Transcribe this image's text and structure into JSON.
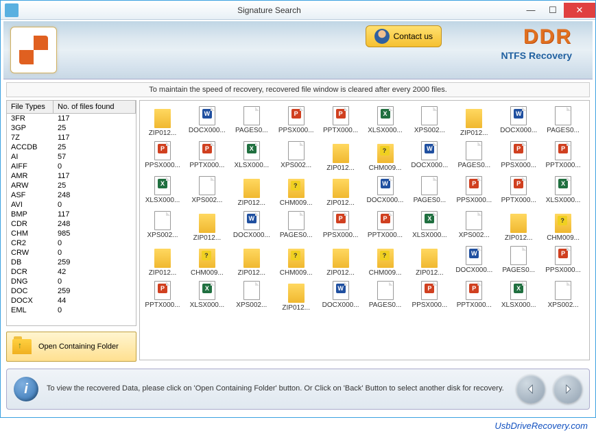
{
  "window": {
    "title": "Signature Search"
  },
  "banner": {
    "contact_label": "Contact us",
    "brand": "DDR",
    "brand_sub": "NTFS Recovery"
  },
  "status_message": "To maintain the speed of recovery, recovered file window is cleared after every 2000 files.",
  "table": {
    "col1": "File Types",
    "col2": "No. of files found",
    "rows": [
      {
        "type": "3FR",
        "count": 117
      },
      {
        "type": "3GP",
        "count": 25
      },
      {
        "type": "7Z",
        "count": 117
      },
      {
        "type": "ACCDB",
        "count": 25
      },
      {
        "type": "AI",
        "count": 57
      },
      {
        "type": "AIFF",
        "count": 0
      },
      {
        "type": "AMR",
        "count": 117
      },
      {
        "type": "ARW",
        "count": 25
      },
      {
        "type": "ASF",
        "count": 248
      },
      {
        "type": "AVI",
        "count": 0
      },
      {
        "type": "BMP",
        "count": 117
      },
      {
        "type": "CDR",
        "count": 248
      },
      {
        "type": "CHM",
        "count": 985
      },
      {
        "type": "CR2",
        "count": 0
      },
      {
        "type": "CRW",
        "count": 0
      },
      {
        "type": "DB",
        "count": 259
      },
      {
        "type": "DCR",
        "count": 42
      },
      {
        "type": "DNG",
        "count": 0
      },
      {
        "type": "DOC",
        "count": 259
      },
      {
        "type": "DOCX",
        "count": 44
      },
      {
        "type": "EML",
        "count": 0
      }
    ]
  },
  "open_folder_label": "Open Containing Folder",
  "grid_items": [
    {
      "label": "ZIP012...",
      "icon": "folder"
    },
    {
      "label": "DOCX000...",
      "icon": "doc-b"
    },
    {
      "label": "PAGES0...",
      "icon": "doc"
    },
    {
      "label": "PPSX000...",
      "icon": "doc-r"
    },
    {
      "label": "PPTX000...",
      "icon": "ppt"
    },
    {
      "label": "XLSX000...",
      "icon": "xls"
    },
    {
      "label": "XPS002...",
      "icon": "doc"
    },
    {
      "label": "ZIP012...",
      "icon": "folder"
    },
    {
      "label": "DOCX000...",
      "icon": "doc-b"
    },
    {
      "label": "PAGES0...",
      "icon": "doc"
    },
    {
      "label": "PPSX000...",
      "icon": "doc-r"
    },
    {
      "label": "PPTX000...",
      "icon": "ppt"
    },
    {
      "label": "XLSX000...",
      "icon": "xls"
    },
    {
      "label": "XPS002...",
      "icon": "doc"
    },
    {
      "label": "ZIP012...",
      "icon": "folder"
    },
    {
      "label": "CHM009...",
      "icon": "chm"
    },
    {
      "label": "DOCX000...",
      "icon": "doc-b"
    },
    {
      "label": "PAGES0...",
      "icon": "doc"
    },
    {
      "label": "PPSX000...",
      "icon": "doc-r"
    },
    {
      "label": "PPTX000...",
      "icon": "ppt"
    },
    {
      "label": "XLSX000...",
      "icon": "xls"
    },
    {
      "label": "XPS002...",
      "icon": "doc"
    },
    {
      "label": "ZIP012...",
      "icon": "folder"
    },
    {
      "label": "CHM009...",
      "icon": "chm"
    },
    {
      "label": "ZIP012...",
      "icon": "folder"
    },
    {
      "label": "DOCX000...",
      "icon": "doc-b"
    },
    {
      "label": "PAGES0...",
      "icon": "doc"
    },
    {
      "label": "PPSX000...",
      "icon": "doc-r"
    },
    {
      "label": "PPTX000...",
      "icon": "ppt"
    },
    {
      "label": "XLSX000...",
      "icon": "xls"
    },
    {
      "label": "XPS002...",
      "icon": "doc"
    },
    {
      "label": "ZIP012...",
      "icon": "folder"
    },
    {
      "label": "DOCX000...",
      "icon": "doc-b"
    },
    {
      "label": "PAGES0...",
      "icon": "doc"
    },
    {
      "label": "PPSX000...",
      "icon": "doc-r"
    },
    {
      "label": "PPTX000...",
      "icon": "ppt"
    },
    {
      "label": "XLSX000...",
      "icon": "xls"
    },
    {
      "label": "XPS002...",
      "icon": "doc"
    },
    {
      "label": "ZIP012...",
      "icon": "folder"
    },
    {
      "label": "CHM009...",
      "icon": "chm"
    },
    {
      "label": "ZIP012...",
      "icon": "folder"
    },
    {
      "label": "CHM009...",
      "icon": "chm"
    },
    {
      "label": "ZIP012...",
      "icon": "folder"
    },
    {
      "label": "CHM009...",
      "icon": "chm"
    },
    {
      "label": "ZIP012...",
      "icon": "folder"
    },
    {
      "label": "CHM009...",
      "icon": "chm"
    },
    {
      "label": "ZIP012...",
      "icon": "folder"
    },
    {
      "label": "DOCX000...",
      "icon": "doc-b"
    },
    {
      "label": "PAGES0...",
      "icon": "doc"
    },
    {
      "label": "PPSX000...",
      "icon": "doc-r"
    },
    {
      "label": "PPTX000...",
      "icon": "ppt"
    },
    {
      "label": "XLSX000...",
      "icon": "xls"
    },
    {
      "label": "XPS002...",
      "icon": "doc"
    },
    {
      "label": "ZIP012...",
      "icon": "folder"
    },
    {
      "label": "DOCX000...",
      "icon": "doc-b"
    },
    {
      "label": "PAGES0...",
      "icon": "doc"
    },
    {
      "label": "PPSX000...",
      "icon": "doc-r"
    },
    {
      "label": "PPTX000...",
      "icon": "ppt"
    },
    {
      "label": "XLSX000...",
      "icon": "xls"
    },
    {
      "label": "XPS002...",
      "icon": "doc"
    }
  ],
  "info_text": "To view the recovered Data, please click on 'Open Containing Folder' button. Or Click on 'Back' Button to select another disk for recovery.",
  "footer_link": "UsbDriveRecovery.com"
}
